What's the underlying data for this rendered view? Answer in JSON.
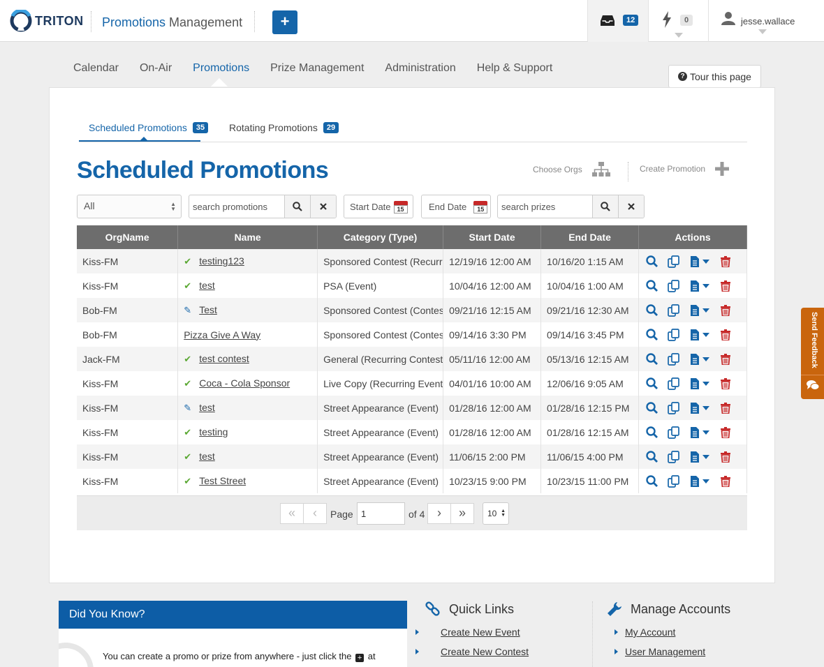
{
  "header": {
    "logo_text": "TRITON",
    "app_title_accent": "Promotions",
    "app_title_rest": " Management",
    "add_button": "+",
    "inbox_count": "12",
    "alerts_count": "0",
    "username": "jesse.wallace"
  },
  "nav": {
    "items": [
      "Calendar",
      "On-Air",
      "Promotions",
      "Prize Management",
      "Administration",
      "Help & Support"
    ],
    "active": "Promotions",
    "tour_label": "Tour this page"
  },
  "subtabs": [
    {
      "label": "Scheduled Promotions",
      "count": "35"
    },
    {
      "label": "Rotating Promotions",
      "count": "29"
    }
  ],
  "page": {
    "title": "Scheduled Promotions",
    "choose_orgs": "Choose Orgs",
    "create_promotion": "Create Promotion"
  },
  "filters": {
    "org_select": "All",
    "search_promotions_placeholder": "search promotions",
    "start_date_placeholder": "Start Date",
    "end_date_placeholder": "End Date",
    "search_prizes_placeholder": "search prizes",
    "calendar_day": "15"
  },
  "table": {
    "columns": [
      "OrgName",
      "Name",
      "Category (Type)",
      "Start Date",
      "End Date",
      "Actions"
    ],
    "rows": [
      {
        "org": "Kiss-FM",
        "status": "check",
        "name": "testing123",
        "category": "Sponsored Contest (Recurring Contest)",
        "start": "12/19/16 12:00 AM",
        "end": "10/16/20 1:15 AM"
      },
      {
        "org": "Kiss-FM",
        "status": "check",
        "name": "test",
        "category": "PSA (Event)",
        "start": "10/04/16 12:00 AM",
        "end": "10/04/16 1:00 AM"
      },
      {
        "org": "Bob-FM",
        "status": "pencil",
        "name": "Test",
        "category": "Sponsored Contest (Contest)",
        "start": "09/21/16 12:15 AM",
        "end": "09/21/16 12:30 AM"
      },
      {
        "org": "Bob-FM",
        "status": "none",
        "name": "Pizza Give A Way",
        "category": "Sponsored Contest (Contest)",
        "start": "09/14/16 3:30 PM",
        "end": "09/14/16 3:45 PM"
      },
      {
        "org": "Jack-FM",
        "status": "check",
        "name": "test contest",
        "category": "General (Recurring Contest)",
        "start": "05/11/16 12:00 AM",
        "end": "05/13/16 12:15 AM"
      },
      {
        "org": "Kiss-FM",
        "status": "check",
        "name": "Coca - Cola Sponsor",
        "category": "Live Copy (Recurring Event)",
        "start": "04/01/16 10:00 AM",
        "end": "12/06/16 9:05 AM"
      },
      {
        "org": "Kiss-FM",
        "status": "pencil",
        "name": "test",
        "category": "Street Appearance (Event)",
        "start": "01/28/16 12:00 AM",
        "end": "01/28/16 12:15 PM"
      },
      {
        "org": "Kiss-FM",
        "status": "check",
        "name": "testing",
        "category": "Street Appearance (Event)",
        "start": "01/28/16 12:00 AM",
        "end": "01/28/16 12:15 AM"
      },
      {
        "org": "Kiss-FM",
        "status": "check",
        "name": "test",
        "category": "Street Appearance (Event)",
        "start": "11/06/15 2:00 PM",
        "end": "11/06/15 4:00 PM"
      },
      {
        "org": "Kiss-FM",
        "status": "check",
        "name": "Test Street",
        "category": "Street Appearance (Event)",
        "start": "10/23/15 9:00 PM",
        "end": "10/23/15 11:00 PM"
      }
    ]
  },
  "pager": {
    "page_label": "Page",
    "page_value": "1",
    "of_label": "of 4",
    "per_page": "10"
  },
  "feedback": {
    "label": "Send Feedback"
  },
  "did_you_know": {
    "title": "Did You Know?",
    "text": "You can create a promo or prize from anywhere - just click the",
    "text_after": "at"
  },
  "quick_links": {
    "title": "Quick Links",
    "items": [
      "Create New Event",
      "Create New Contest"
    ]
  },
  "manage_accounts": {
    "title": "Manage Accounts",
    "items": [
      "My Account",
      "User Management"
    ]
  },
  "colors": {
    "brand_blue": "#1565a9",
    "header_grey": "#6d6d6d",
    "danger": "#c62828",
    "success": "#5aa832",
    "feedback_orange": "#c9650d"
  }
}
